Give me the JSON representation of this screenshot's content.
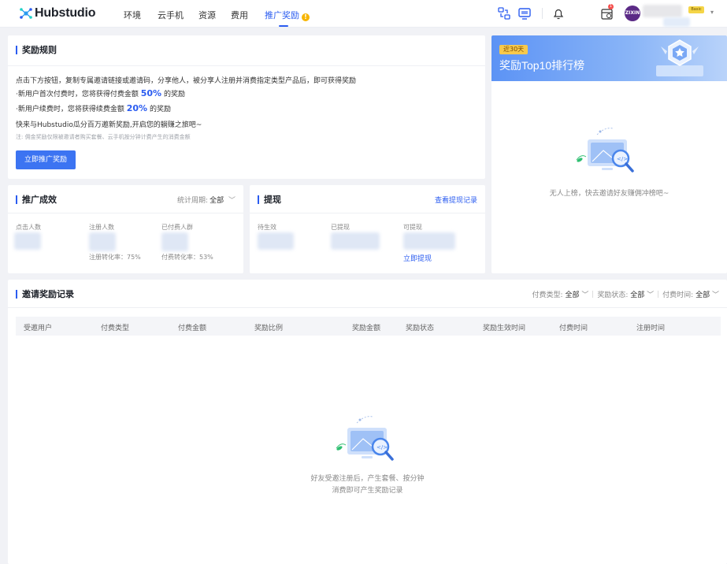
{
  "app": {
    "logo_text": "Hubstudio"
  },
  "nav": {
    "items": [
      {
        "label": "环境"
      },
      {
        "label": "云手机"
      },
      {
        "label": "资源"
      },
      {
        "label": "费用"
      },
      {
        "label": "推广奖励"
      }
    ],
    "active_index": 4,
    "dot_text": "!"
  },
  "user": {
    "avatar_text": "ZIXIN",
    "plan_badge": "Basic",
    "notification_count": "1"
  },
  "rules": {
    "title": "奖励规则",
    "intro": "点击下方按钮，复制专属邀请链接或邀请码，分享他人，被分享人注册并消费指定类型产品后，即可获得奖励",
    "line1_prefix": "·新用户首次付费时，您将获得付费金额",
    "line1_value": "50%",
    "line1_suffix": "的奖励",
    "line2_prefix": "·新用户续费时，您将获得续费金额",
    "line2_value": "20%",
    "line2_suffix": "的奖励",
    "line3": "快来与Hubstudio瓜分百万邀新奖励,开启您的躺赚之旅吧~",
    "note": "注: 佣金奖励仅限被邀请者购买套餐、云手机按分钟计费产生的消费金额",
    "button": "立即推广奖励"
  },
  "promo": {
    "title": "推广成效",
    "period_label": "统计周期:",
    "period_value": "全部",
    "stats": [
      {
        "label": "点击人数"
      },
      {
        "label": "注册人数",
        "sub": "注册转化率：75%"
      },
      {
        "label": "已付费人群",
        "sub": "付费转化率：53%"
      }
    ]
  },
  "withdraw": {
    "title": "提现",
    "history_link": "查看提现记录",
    "stats": [
      {
        "label": "待生效"
      },
      {
        "label": "已提现"
      },
      {
        "label": "可提现"
      }
    ],
    "withdraw_link": "立即提现"
  },
  "leaderboard": {
    "tag": "近30天",
    "title": "奖励Top10排行榜",
    "empty_text": "无人上榜，快去邀请好友赚佣冲榜吧~"
  },
  "records": {
    "title": "邀请奖励记录",
    "filters": [
      {
        "label": "付费类型:",
        "value": "全部"
      },
      {
        "label": "奖励状态:",
        "value": "全部"
      },
      {
        "label": "付费时间:",
        "value": "全部"
      }
    ],
    "columns": [
      "受邀用户",
      "付费类型",
      "付费金额",
      "奖励比例",
      "奖励金额",
      "奖励状态",
      "奖励生效时间",
      "付费时间",
      "注册时间"
    ],
    "empty_line1": "好友受邀注册后，产生套餐、按分钟",
    "empty_line2": "消费即可产生奖励记录"
  },
  "colors": {
    "accent": "#2b5cf0",
    "button": "#3c74f2",
    "badge": "#f7b500",
    "banner": "#5c93f5"
  },
  "icons": [
    "hubstudio-logo-icon",
    "sync-devices-icon",
    "monitor-icon",
    "bell-icon",
    "calendar-icon",
    "chevron-down-icon",
    "empty-monitor-illustration"
  ]
}
